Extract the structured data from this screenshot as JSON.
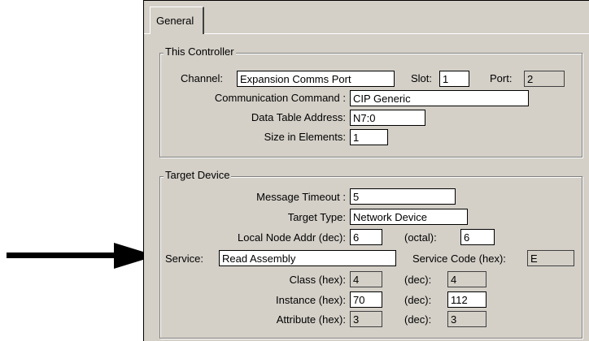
{
  "tab": {
    "label": "General"
  },
  "this_controller": {
    "title": "This Controller",
    "channel_label": "Channel:",
    "channel_value": "Expansion Comms Port",
    "slot_label": "Slot:",
    "slot_value": "1",
    "port_label": "Port:",
    "port_value": "2",
    "comm_command_label": "Communication Command :",
    "comm_command_value": "CIP Generic",
    "data_table_label": "Data Table Address:",
    "data_table_value": "N7:0",
    "size_label": "Size in Elements:",
    "size_value": "1"
  },
  "target_device": {
    "title": "Target Device",
    "timeout_label": "Message Timeout :",
    "timeout_value": "5",
    "target_type_label": "Target Type:",
    "target_type_value": "Network Device",
    "local_node_label": "Local Node Addr (dec):",
    "local_node_value": "6",
    "octal_label": "(octal):",
    "octal_value": "6",
    "service_label": "Service:",
    "service_value": "Read Assembly",
    "service_code_label": "Service Code (hex):",
    "service_code_value": "E",
    "class_label": "Class (hex):",
    "class_hex": "4",
    "class_dec_label": "(dec):",
    "class_dec": "4",
    "instance_label": "Instance (hex):",
    "instance_hex": "70",
    "instance_dec_label": "(dec):",
    "instance_dec": "112",
    "attribute_label": "Attribute (hex):",
    "attribute_hex": "3",
    "attribute_dec_label": "(dec):",
    "attribute_dec": "3"
  },
  "pointer_arrow": {
    "icon": "right-arrow-icon",
    "color": "#000000"
  }
}
